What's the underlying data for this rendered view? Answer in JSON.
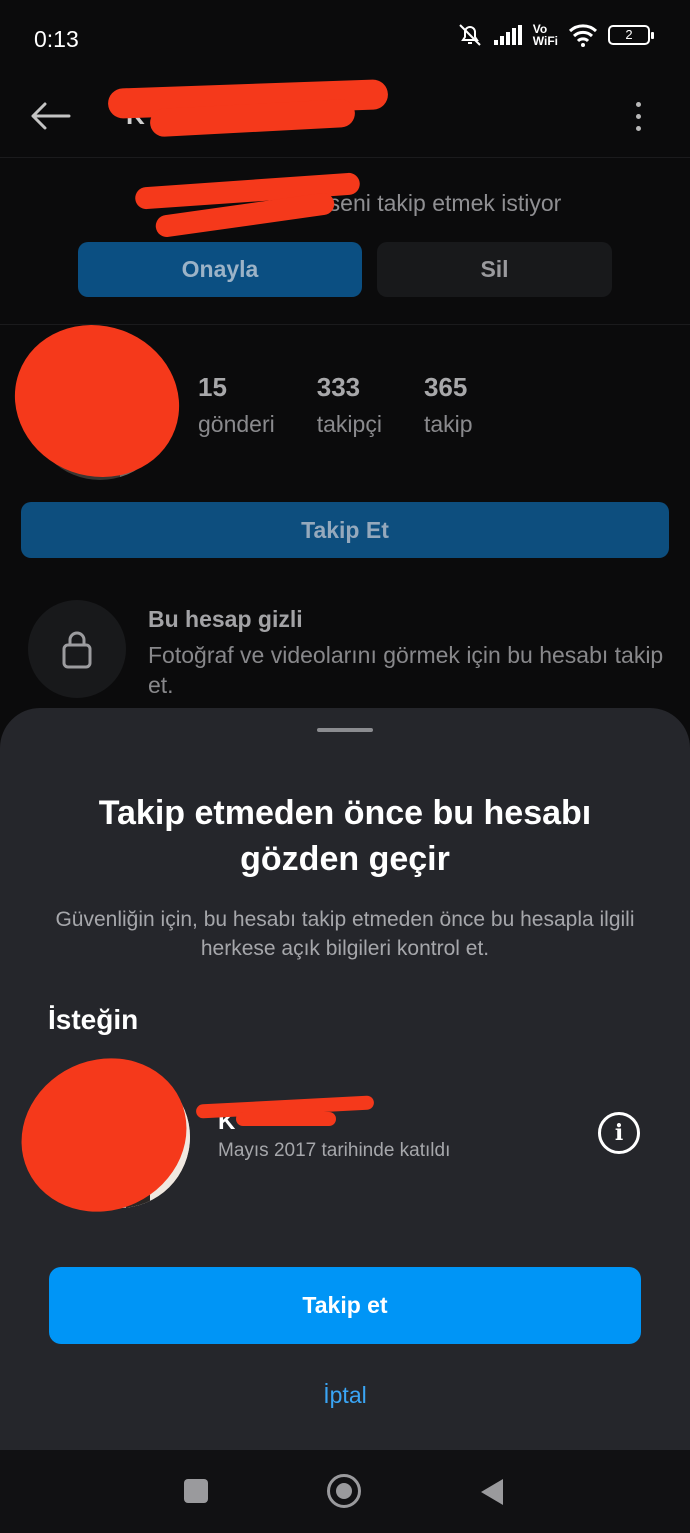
{
  "status_bar": {
    "time": "0:13",
    "vowifi_line1": "Vo",
    "vowifi_line2": "WiFi",
    "battery": "2"
  },
  "header": {
    "username": "K"
  },
  "follow_request": {
    "message": "seni takip etmek istiyor",
    "approve_label": "Onayla",
    "delete_label": "Sil"
  },
  "profile": {
    "stats": [
      {
        "value": "15",
        "label": "gönderi"
      },
      {
        "value": "333",
        "label": "takipçi"
      },
      {
        "value": "365",
        "label": "takip"
      }
    ],
    "follow_label": "Takip Et"
  },
  "private_notice": {
    "title": "Bu hesap gizli",
    "description": "Fotoğraf ve videolarını görmek için bu hesabı takip et."
  },
  "sheet": {
    "title": "Takip etmeden önce bu hesabı gözden geçir",
    "description": "Güvenliğin için, bu hesabı takip etmeden önce bu hesapla ilgili herkese açık bilgileri kontrol et.",
    "section_label": "İsteğin",
    "account_name": "K",
    "account_joined": "Mayıs 2017 tarihinde katıldı",
    "info_icon": "i",
    "primary_label": "Takip et",
    "cancel_label": "İptal"
  },
  "colors": {
    "primary": "#0095f6",
    "sheet_bg": "#25262b",
    "redaction": "#f5391b"
  }
}
